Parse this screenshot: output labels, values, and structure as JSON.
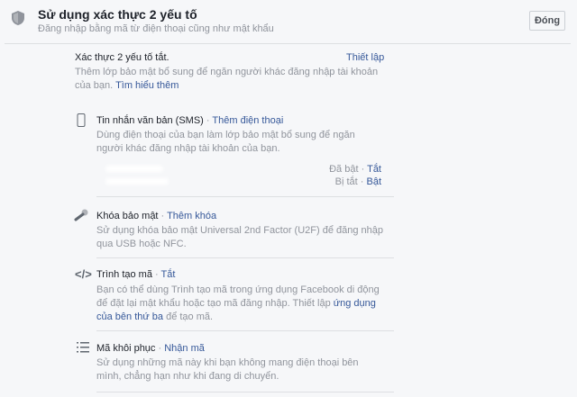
{
  "header": {
    "title": "Sử dụng xác thực 2 yếu tố",
    "subtitle": "Đăng nhập bằng mã từ điện thoại cũng như mật khẩu",
    "close_label": "Đóng"
  },
  "status": {
    "text": "Xác thực 2 yếu tố tắt.",
    "setup_label": "Thiết lập",
    "description": "Thêm lớp bảo mật bổ sung để ngăn người khác đăng nhập tài khoản của bạn.",
    "learn_more": "Tìm hiểu thêm"
  },
  "sms": {
    "title": "Tin nhắn văn bản (SMS)",
    "sep": " · ",
    "action": "Thêm điện thoại",
    "description": "Dùng điện thoại của bạn làm lớp bảo mật bổ sung để ngăn người khác đăng nhập tài khoản của bạn.",
    "phones": [
      {
        "state": "Đã bật",
        "action": "Tắt"
      },
      {
        "state": "Bị tắt",
        "action": "Bật"
      }
    ]
  },
  "key": {
    "title": "Khóa bảo mật",
    "action": "Thêm khóa",
    "description": "Sử dụng khóa bảo mật Universal 2nd Factor (U2F) để đăng nhập qua USB hoặc NFC."
  },
  "generator": {
    "title": "Trình tạo mã",
    "action": "Tắt",
    "description_pre": "Bạn có thể dùng Trình tạo mã trong ứng dụng Facebook di động để đặt lại mật khẩu hoặc tạo mã đăng nhập. Thiết lập ",
    "link": "ứng dụng của bên thứ ba",
    "description_post": " để tạo mã."
  },
  "recovery": {
    "title": "Mã khôi phục",
    "action": "Nhận mã",
    "description": "Sử dụng những mã này khi bạn không mang điện thoại bên mình, chẳng hạn như khi đang di chuyển."
  },
  "dot": " · "
}
